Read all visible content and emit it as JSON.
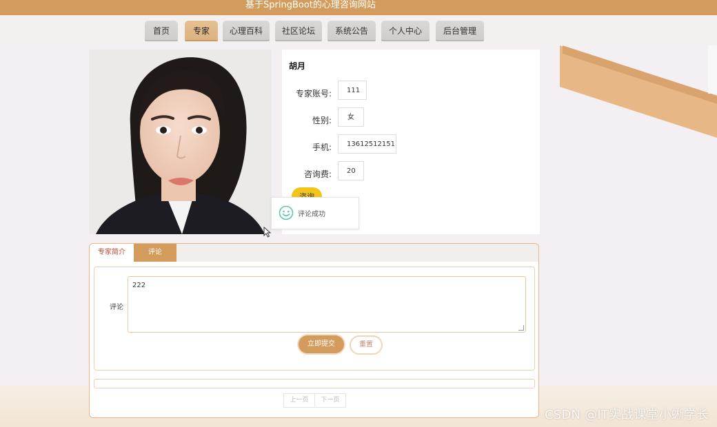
{
  "site_title": "基于SpringBoot的心理咨询网站",
  "nav": {
    "items": [
      {
        "label": "首页"
      },
      {
        "label": "专家"
      },
      {
        "label": "心理百科"
      },
      {
        "label": "社区论坛"
      },
      {
        "label": "系统公告"
      },
      {
        "label": "个人中心"
      },
      {
        "label": "后台管理"
      }
    ],
    "active": "专家"
  },
  "expert": {
    "name": "胡月",
    "fields": [
      {
        "label": "专家账号:",
        "value": "111"
      },
      {
        "label": "性别:",
        "value": "女"
      },
      {
        "label": "手机:",
        "value": "13612512151"
      },
      {
        "label": "咨询费:",
        "value": "20"
      }
    ],
    "consult_label": "咨询"
  },
  "toast": {
    "text": "评论成功"
  },
  "tabs": {
    "items": [
      {
        "label": "专家简介"
      },
      {
        "label": "评论"
      }
    ],
    "active": "评论"
  },
  "comment_form": {
    "label": "评论",
    "value": "222",
    "submit_label": "立即提交",
    "reset_label": "重置"
  },
  "pager": {
    "prev_label": "上一页",
    "next_label": "下一页"
  },
  "watermark": "CSDN @IT实战课堂小蜥学长",
  "colors": {
    "accent": "#d39b5c",
    "consult": "#f2c51b",
    "active_tab_text": "#d0442a"
  }
}
